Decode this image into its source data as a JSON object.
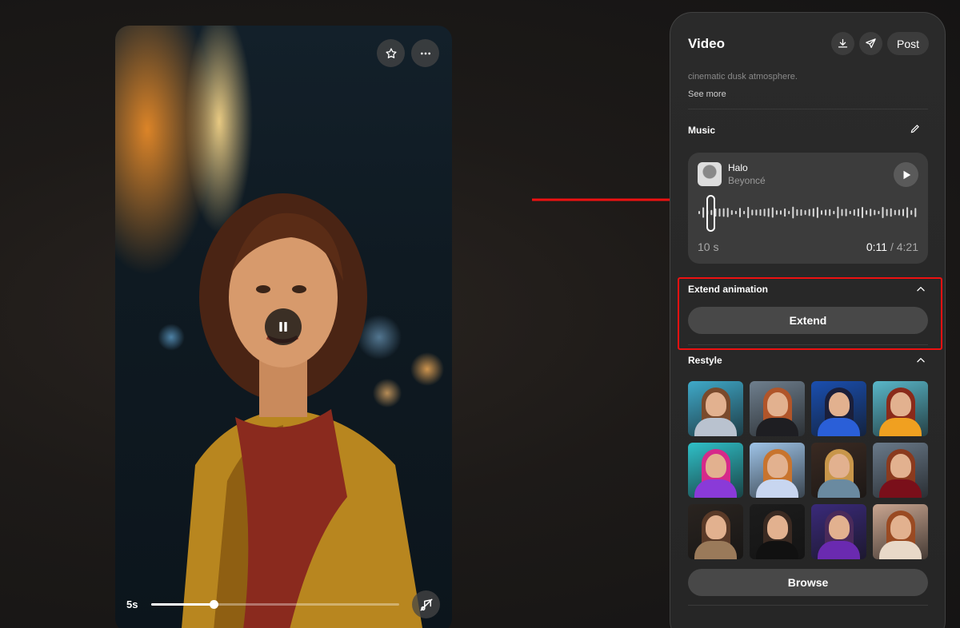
{
  "player": {
    "current_time_label": "5s",
    "progress": 0.25
  },
  "panel": {
    "title": "Video",
    "post_label": "Post",
    "description_snippet": "cinematic dusk atmosphere.",
    "see_more_label": "See more",
    "music": {
      "section_title": "Music",
      "song_title": "Halo",
      "artist": "Beyoncé",
      "clip_length": "10 s",
      "position": "0:11",
      "separator": " / ",
      "duration": "4:21"
    },
    "extend": {
      "section_title": "Extend animation",
      "button_label": "Extend"
    },
    "restyle": {
      "section_title": "Restyle",
      "browse_label": "Browse",
      "styles": [
        {
          "bg": "#3fa9c9",
          "hair": "#7a4a2c",
          "body": "#b9c2cf"
        },
        {
          "bg": "#6f7f8e",
          "hair": "#b0552a",
          "body": "#1e1e22"
        },
        {
          "bg": "#1a4fb0",
          "hair": "#1b1f3a",
          "body": "#2a5fd8"
        },
        {
          "bg": "#59b7c9",
          "hair": "#8a2a1a",
          "body": "#f0a020"
        },
        {
          "bg": "#2fc0c8",
          "hair": "#d62a8a",
          "body": "#8a3ad8"
        },
        {
          "bg": "#9fc4e8",
          "hair": "#c8742e",
          "body": "#c8d6f0"
        },
        {
          "bg": "#3a2a22",
          "hair": "#c8964a",
          "body": "#6a8aa0"
        },
        {
          "bg": "#6a7a8a",
          "hair": "#8a3a1e",
          "body": "#7a0f1a"
        },
        {
          "bg": "#2a2420",
          "hair": "#5a3a28",
          "body": "#9a7a5a"
        },
        {
          "bg": "#1c1c1c",
          "hair": "#3a2a22",
          "body": "#111111"
        },
        {
          "bg": "#3a2a7a",
          "hair": "#4a2a5a",
          "body": "#6a2ab0"
        },
        {
          "bg": "#c9a590",
          "hair": "#9a4a22",
          "body": "#e8d8c8"
        }
      ]
    }
  }
}
